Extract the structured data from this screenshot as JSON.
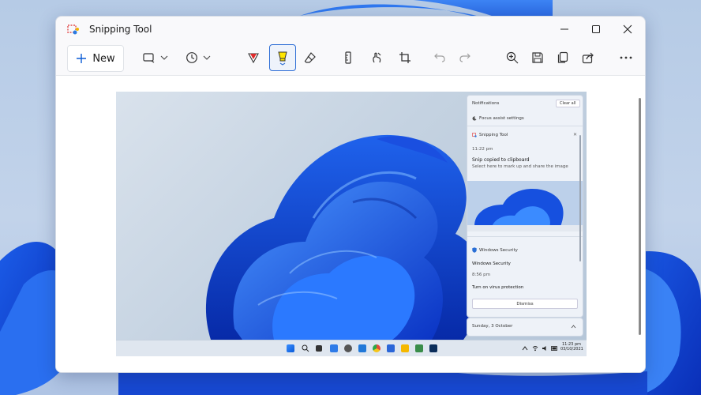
{
  "app": {
    "title": "Snipping Tool"
  },
  "toolbar": {
    "new_label": "New"
  },
  "screenshot": {
    "notifications": {
      "header": "Notifications",
      "clear_label": "Clear all",
      "focus_assist": "Focus assist settings",
      "snip_app": "Snipping Tool",
      "snip_time": "11:22 pm",
      "snip_title": "Snip copied to clipboard",
      "snip_body": "Select here to mark up and share the image",
      "security_app": "Windows Security",
      "security_title": "Windows Security",
      "security_time": "8:56 pm",
      "security_body": "Turn on virus protection",
      "dismiss_label": "Dismiss",
      "date_label": "Sunday, 3 October"
    },
    "taskbar": {
      "time": "11:23 pm",
      "date": "03/10/2021"
    }
  }
}
